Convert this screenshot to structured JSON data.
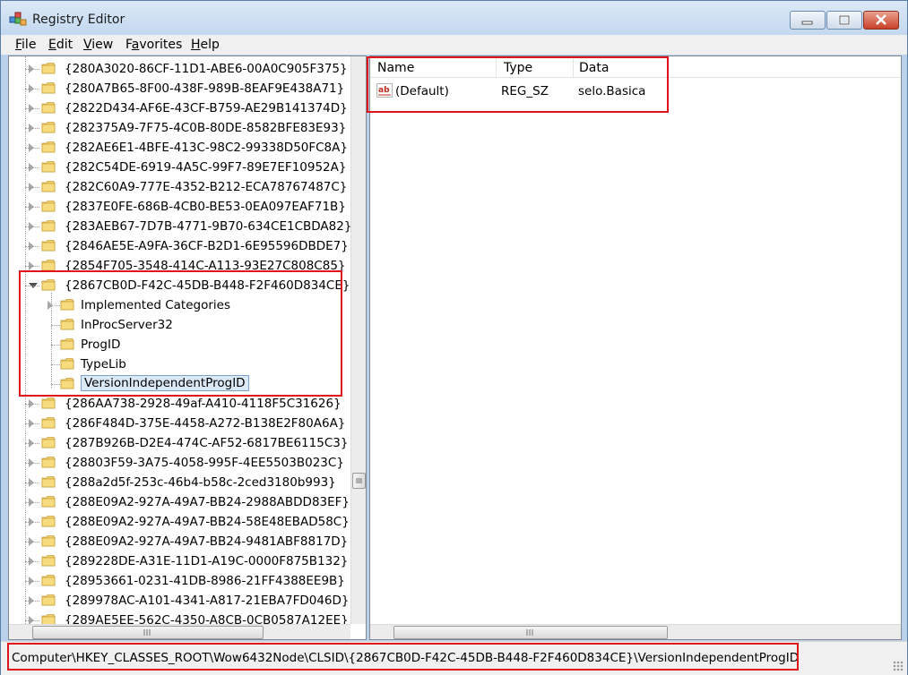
{
  "window": {
    "title": "Registry Editor",
    "accent_color": "#e0151b"
  },
  "menu": [
    {
      "acc": "F",
      "rest": "ile"
    },
    {
      "acc": "E",
      "rest": "dit"
    },
    {
      "acc": "V",
      "rest": "iew"
    },
    {
      "acc": "a",
      "pre": "F",
      "rest": "vorites"
    },
    {
      "acc": "H",
      "rest": "elp"
    }
  ],
  "tree": {
    "before": [
      "{280A3020-86CF-11D1-ABE6-00A0C905F375}",
      "{280A7B65-8F00-438F-989B-8EAF9E438A71}",
      "{2822D434-AF6E-43CF-B759-AE29B141374D}",
      "{282375A9-7F75-4C0B-80DE-8582BFE83E93}",
      "{282AE6E1-4BFE-413C-98C2-99338D50FC8A}",
      "{282C54DE-6919-4A5C-99F7-89E7EF10952A}",
      "{282C60A9-777E-4352-B212-ECA78767487C}",
      "{2837E0FE-686B-4CB0-BE53-0EA097EAF71B}",
      "{283AEB67-7D7B-4771-9B70-634CE1CBDA82}",
      "{2846AE5E-A9FA-36CF-B2D1-6E95596DBDE7}",
      "{2854F705-3548-414C-A113-93E27C808C85}"
    ],
    "expanded": "{2867CB0D-F42C-45DB-B448-F2F460D834CE}",
    "children": [
      "Implemented Categories",
      "InProcServer32",
      "ProgID",
      "TypeLib",
      "VersionIndependentProgID"
    ],
    "after": [
      "{286AA738-2928-49af-A410-4118F5C31626}",
      "{286F484D-375E-4458-A272-B138E2F80A6A}",
      "{287B926B-D2E4-474C-AF52-6817BE6115C3}",
      "{28803F59-3A75-4058-995F-4EE5503B023C}",
      "{288a2d5f-253c-46b4-b58c-2ced3180b993}",
      "{288E09A2-927A-49A7-BB24-2988ABDD83EF}",
      "{288E09A2-927A-49A7-BB24-58E48EBAD58C}",
      "{288E09A2-927A-49A7-BB24-9481ABF8817D}",
      "{289228DE-A31E-11D1-A19C-0000F875B132}",
      "{28953661-0231-41DB-8986-21FF4388EE9B}",
      "{289978AC-A101-4341-A817-21EBA7FD046D}",
      "{289AE5EE-562C-4350-A8CB-0CB0587A12EE}"
    ]
  },
  "list": {
    "headers": [
      "Name",
      "Type",
      "Data"
    ],
    "rows": [
      {
        "name": "(Default)",
        "type": "REG_SZ",
        "data": "selo.Basica"
      }
    ]
  },
  "status": "Computer\\HKEY_CLASSES_ROOT\\Wow6432Node\\CLSID\\{2867CB0D-F42C-45DB-B448-F2F460D834CE}\\VersionIndependentProgID"
}
